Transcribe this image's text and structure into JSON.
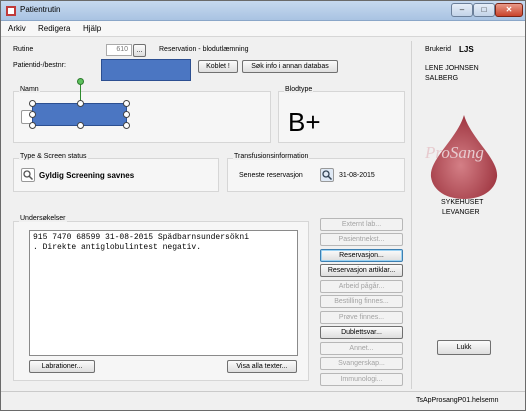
{
  "window": {
    "title": "Patientrutin",
    "minimize": "–",
    "maximize": "□",
    "close": "✕"
  },
  "menu": [
    "Arkiv",
    "Redigera",
    "Hjälp"
  ],
  "header": {
    "rutine_label": "Rutine",
    "rutine_value": "610",
    "rutine_btn": "...",
    "rutine_desc": "Reservation - blodutlæmning",
    "patient_label": "Patientid-/bestnr:",
    "koblet_btn": "Koblet !",
    "sok_btn": "Søk info i annan databas"
  },
  "groups": {
    "namn": "Namn",
    "blodtype": "Blodtype",
    "blodtype_value": "B+",
    "screen_title": "Type & Screen status",
    "screen_status": "Gyldig Screening savnes",
    "trans_title": "Transfusionsinformation",
    "seneste_label": "Seneste reservasjon",
    "seneste_date": "31-08-2015",
    "undersok_title": "Undersøkelser"
  },
  "undersokelser_text": "915 7470 68599 31-08-2015 Spädbarnsundersökni\n. Direkte antiglobulintest negativ.",
  "bottom_buttons": {
    "lab": "Labrationer...",
    "visa": "Visa alla texter..."
  },
  "side_buttons": [
    {
      "label": "Externt lab...",
      "enabled": false
    },
    {
      "label": "Pasientnekst...",
      "enabled": false
    },
    {
      "label": "Reservasjon...",
      "enabled": true,
      "default": true
    },
    {
      "label": "Reservasjon artiklar...",
      "enabled": true
    },
    {
      "label": "Arbeid pågår...",
      "enabled": false
    },
    {
      "label": "Bestilling finnes...",
      "enabled": false
    },
    {
      "label": "Prøve finnes...",
      "enabled": false
    },
    {
      "label": "Dublettsvar...",
      "enabled": true
    },
    {
      "label": "Annet...",
      "enabled": false
    },
    {
      "label": "Svangerskap...",
      "enabled": false
    },
    {
      "label": "Immunologi...",
      "enabled": false
    }
  ],
  "right": {
    "brukerid_label": "Brukerid",
    "brukerid_value": "LJS",
    "user_name_1": "LENE JOHNSEN",
    "user_name_2": "SALBERG",
    "logo": "ProSang",
    "hospital_1": "SYKEHUSET",
    "hospital_2": "LEVANGER",
    "lukk_btn": "Lukk"
  },
  "status": "TsApProsangP01.helsemn",
  "colors": {
    "title_bar": "#b8cfe9",
    "blood": "#b5464f",
    "selected_shape": "#4b76c2"
  }
}
